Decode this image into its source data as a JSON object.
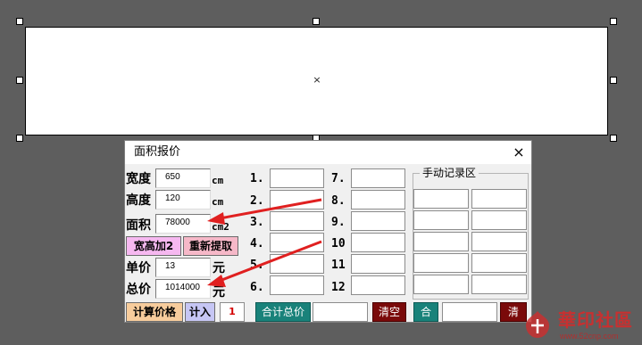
{
  "canvas": {
    "center_mark": "×"
  },
  "dialog": {
    "title": "面积报价",
    "close_icon": "×",
    "left": {
      "width_label": "宽度",
      "width_value": "650",
      "width_unit": "cm",
      "height_label": "高度",
      "height_value": "120",
      "height_unit": "cm",
      "area_label": "面积",
      "area_value": "78000",
      "area_unit": "cm2",
      "add_two_button": "宽高加2",
      "refetch_button": "重新提取",
      "unit_price_label": "单价",
      "unit_price_value": "13",
      "unit_price_unit": "元",
      "total_price_label": "总价",
      "total_price_value": "1014000",
      "total_price_unit": "元",
      "calc_button": "计算价格",
      "add_button": "计入",
      "counter": "1"
    },
    "records": {
      "numbers_col1": [
        "1.",
        "2.",
        "3.",
        "4.",
        "5.",
        "6."
      ],
      "numbers_col2": [
        "7.",
        "8.",
        "9.",
        "10",
        "11",
        "12"
      ],
      "sum_button": "合计总价",
      "clear_button": "清空"
    },
    "manual": {
      "legend": "手动记录区",
      "sum_button": "合",
      "clear_button": "清"
    }
  },
  "watermark": {
    "name": "華印社區",
    "url": "www.52cnp.com"
  },
  "colors": {
    "arrow": "#e02020",
    "teal": "#19827a",
    "maroon": "#7a0a0a"
  }
}
